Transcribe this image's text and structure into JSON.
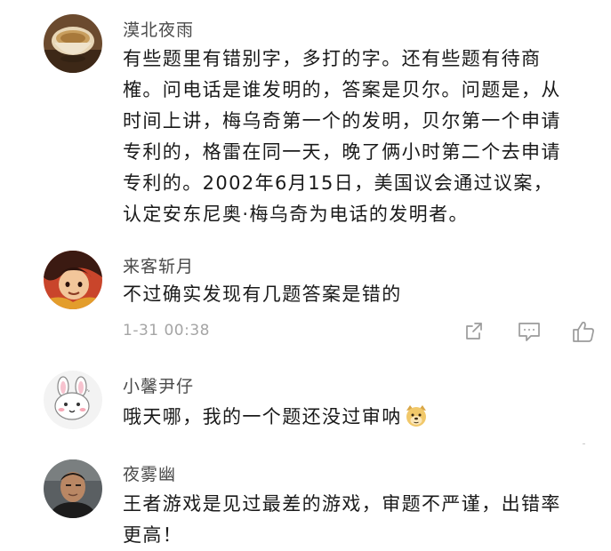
{
  "comments": [
    {
      "author": "漠北夜雨",
      "avatar": "teacup-avatar",
      "lines": [
        "有些题里有错别字，多打的字。还有些题有待商",
        "榷。问电话是谁发明的，答案是贝尔。问题是，从",
        "时间上讲，梅乌奇第一个的发明，贝尔第一个申请",
        "专利的，格雷在同一天，晚了俩小时第二个去申请",
        "专利的。2002年6月15日，美国议会通过议案，",
        "认定安东尼奥·梅乌奇为电话的发明者。"
      ]
    },
    {
      "author": "来客斩月",
      "avatar": "anime-character-avatar",
      "lines": [
        "不过确实发现有几题答案是错的"
      ],
      "timestamp": "1-31 00:38",
      "actions": [
        "share-icon",
        "comment-icon",
        "like-icon"
      ]
    },
    {
      "author": "小馨尹仔",
      "avatar": "cartoon-bunny-avatar",
      "text": "哦天哪，我的一个题还没过审呐",
      "emoji": "doge-emoji"
    },
    {
      "author": "夜雾幽",
      "avatar": "man-photo-avatar",
      "lines": [
        "王者游戏是见过最差的游戏，审题不严谨，出错率",
        "更高！"
      ]
    }
  ],
  "colors": {
    "author": "#4a4a4a",
    "body_text": "#1a1a1a",
    "meta_text": "#a5a5a5",
    "icon": "#9b9b9b"
  }
}
